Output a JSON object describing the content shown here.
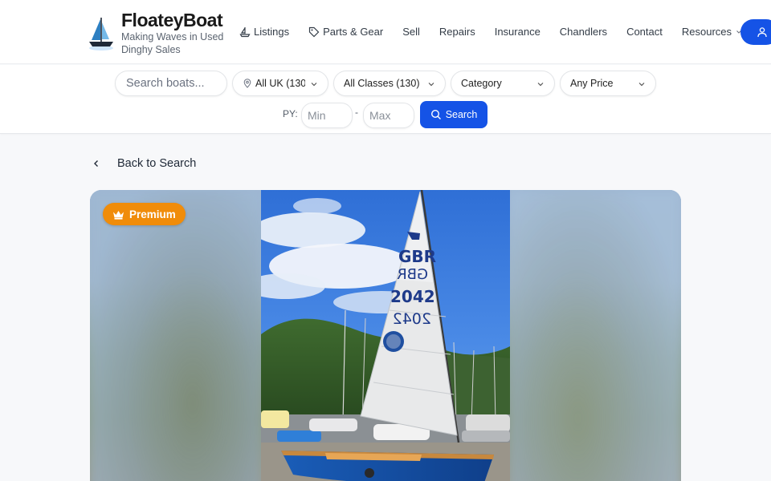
{
  "brand": {
    "name": "FloateyBoat",
    "tagline": "Making Waves in Used Dinghy Sales"
  },
  "nav": {
    "items": [
      {
        "label": "Listings",
        "icon": "boat-icon"
      },
      {
        "label": "Parts & Gear",
        "icon": "tag-icon"
      },
      {
        "label": "Sell"
      },
      {
        "label": "Repairs"
      },
      {
        "label": "Insurance"
      },
      {
        "label": "Chandlers"
      },
      {
        "label": "Contact"
      },
      {
        "label": "Resources",
        "icon": "chevron-down-icon"
      }
    ],
    "account_icon": "user-icon"
  },
  "filters": {
    "search_placeholder": "Search boats...",
    "location": "All UK (130)",
    "classes": "All Classes (130)",
    "category": "Category",
    "price": "Any Price",
    "py_label": "PY:",
    "min_placeholder": "Min",
    "max_placeholder": "Max",
    "dash": "-",
    "search_button": "Search"
  },
  "back_link": "Back to Search",
  "listing": {
    "badge": "Premium",
    "sail_country": "GBR",
    "sail_number": "2042"
  },
  "colors": {
    "accent": "#1553e6",
    "premium": "#f08c0a"
  }
}
